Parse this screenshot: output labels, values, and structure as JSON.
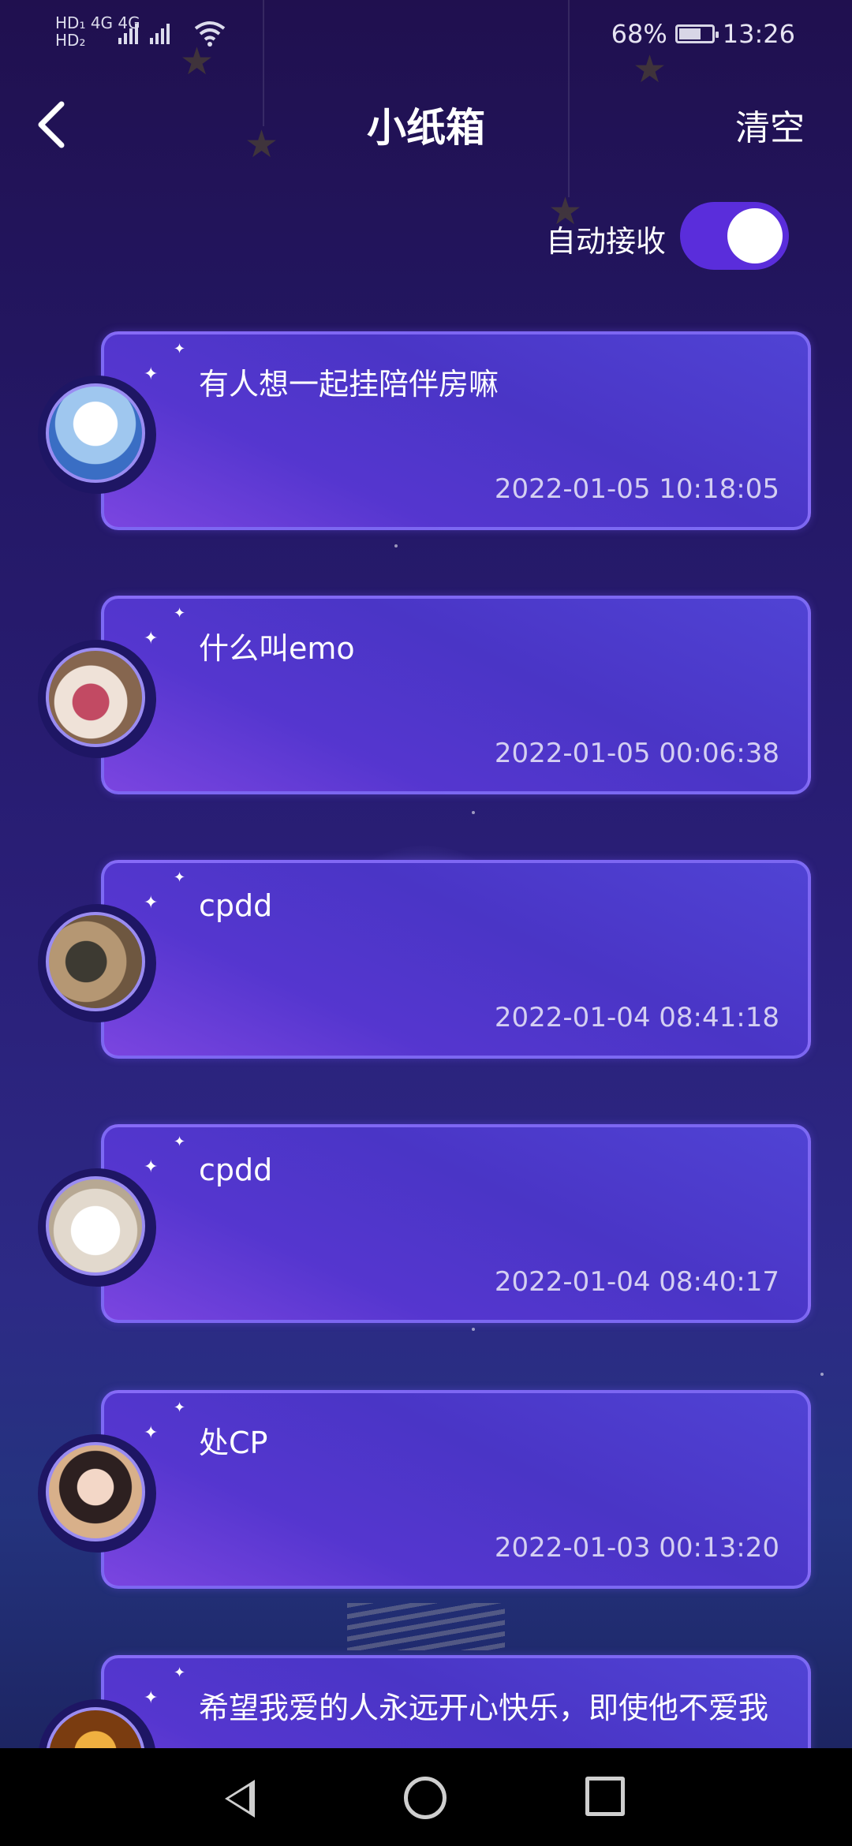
{
  "status_bar": {
    "network_line1": "HD₁ 4G 4G",
    "network_line2": "HD₂",
    "signal_icon": "cell-signal-icon",
    "wifi_icon": "wifi-icon",
    "battery_percent": "68%",
    "battery_level": 0.68,
    "time": "13:26"
  },
  "header": {
    "back_icon": "chevron-left-icon",
    "title": "小纸箱",
    "clear_label": "清空"
  },
  "auto_receive": {
    "label": "自动接收",
    "enabled": true,
    "accent_color": "#5a2ddb"
  },
  "messages": [
    {
      "text": "有人想一起挂陪伴房嘛",
      "time": "2022-01-05 10:18:05"
    },
    {
      "text": "什么叫emo",
      "time": "2022-01-05 00:06:38"
    },
    {
      "text": "cpdd",
      "time": "2022-01-04 08:41:18"
    },
    {
      "text": "cpdd",
      "time": "2022-01-04 08:40:17"
    },
    {
      "text": "处CP",
      "time": "2022-01-03 00:13:20"
    },
    {
      "text": "希望我爱的人永远开心快乐，即使他不爱我",
      "time": ""
    }
  ],
  "nav_bar": {
    "back_icon": "triangle-back-icon",
    "home_icon": "circle-home-icon",
    "recent_icon": "square-recents-icon"
  }
}
